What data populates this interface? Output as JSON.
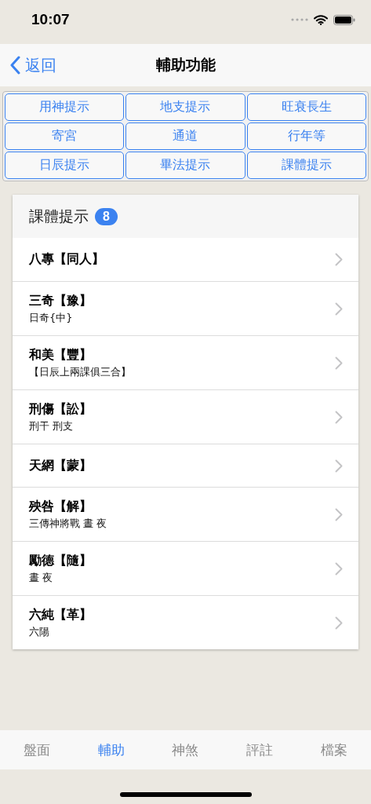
{
  "status_bar": {
    "time": "10:07"
  },
  "nav": {
    "back": "返回",
    "title": "輔助功能"
  },
  "function_buttons": [
    "用神提示",
    "地支提示",
    "旺衰長生",
    "寄宮",
    "通道",
    "行年等",
    "日辰提示",
    "畢法提示",
    "課體提示"
  ],
  "card": {
    "title": "課體提示",
    "count": "8",
    "rows": [
      {
        "title": "八專【同人】"
      },
      {
        "title": "三奇【豫】",
        "subtitle": "日奇{中}"
      },
      {
        "title": "和美【豐】",
        "subtitle": "【日辰上兩課俱三合】"
      },
      {
        "title": "刑傷【訟】",
        "subtitle": "刑干 刑支"
      },
      {
        "title": "天網【蒙】"
      },
      {
        "title": "殃咎【解】",
        "subtitle": "三傳神將戰 晝 夜"
      },
      {
        "title": "勵德【隨】",
        "subtitle": "晝 夜"
      },
      {
        "title": "六純【革】",
        "subtitle": "六陽"
      }
    ]
  },
  "tab_bar": [
    {
      "label": "盤面",
      "selected": false
    },
    {
      "label": "輔助",
      "selected": true
    },
    {
      "label": "神煞",
      "selected": false
    },
    {
      "label": "評註",
      "selected": false
    },
    {
      "label": "檔案",
      "selected": false
    }
  ]
}
